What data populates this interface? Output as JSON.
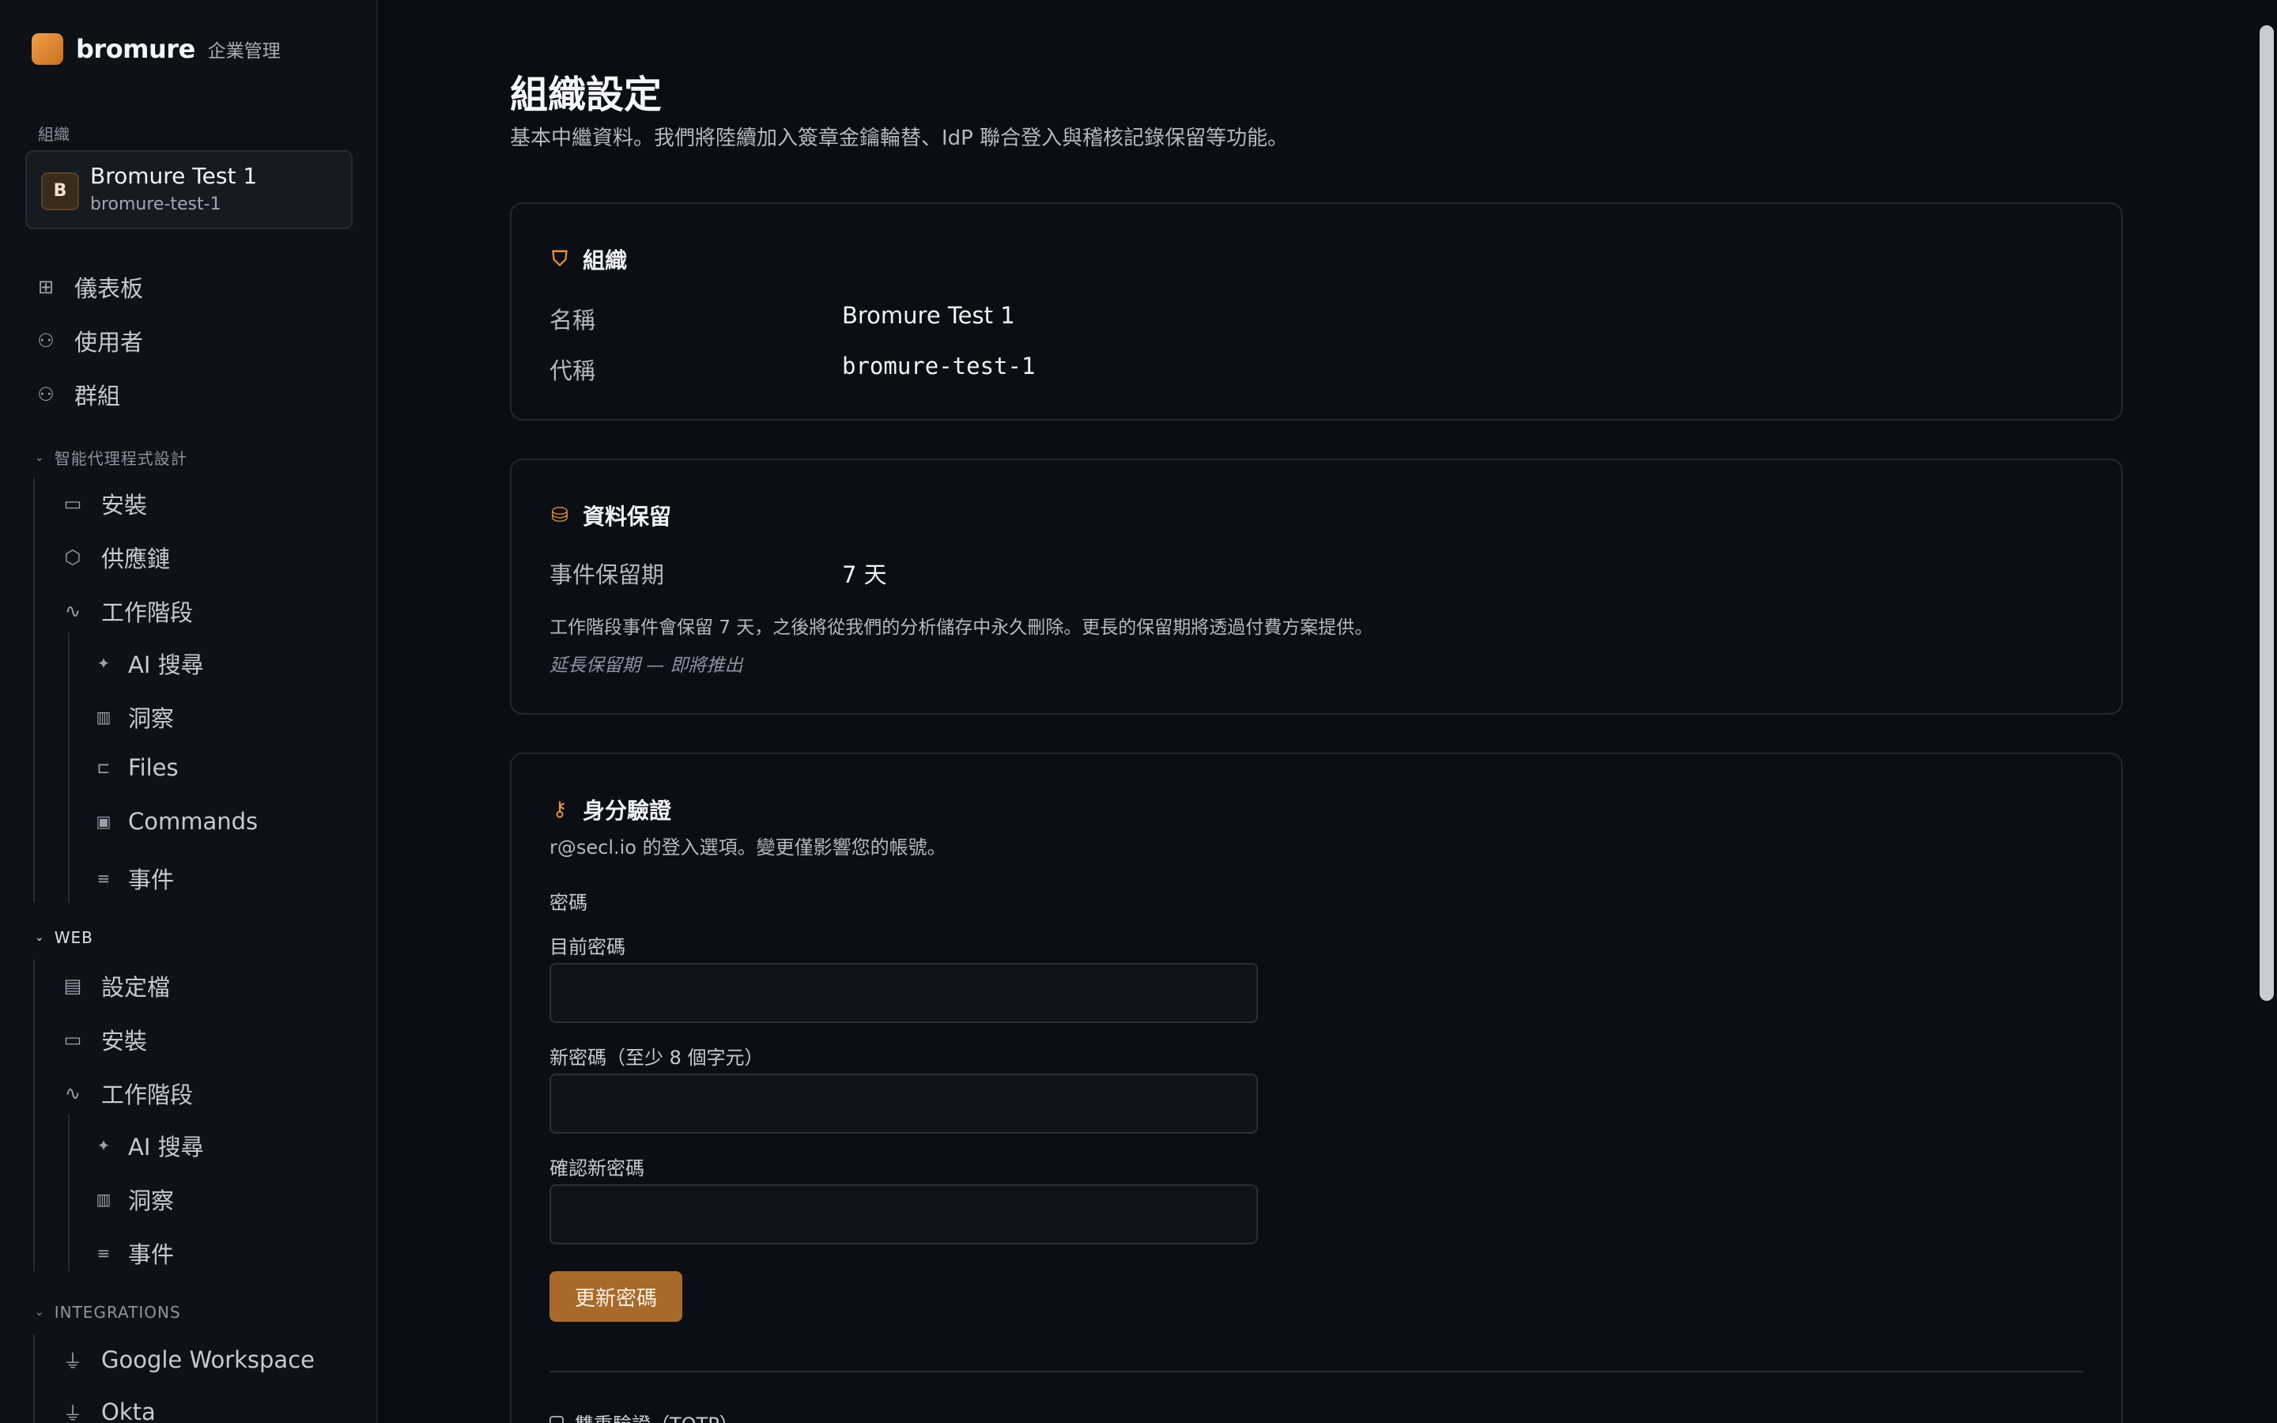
{
  "brand": {
    "name": "bromure",
    "subtitle": "企業管理",
    "logo_color": "#e08a34"
  },
  "org": {
    "section_label": "組織",
    "avatar": "B",
    "name": "Bromure Test 1",
    "slug": "bromure-test-1"
  },
  "nav": {
    "top": [
      {
        "label": "儀表板",
        "icon": "dashboard-icon"
      },
      {
        "label": "使用者",
        "icon": "users-icon"
      },
      {
        "label": "群組",
        "icon": "group-icon"
      }
    ],
    "agents": {
      "header": "智能代理程式設計",
      "items": [
        {
          "label": "安裝",
          "icon": "laptop-icon"
        },
        {
          "label": "供應鏈",
          "icon": "package-icon"
        },
        {
          "label": "工作階段",
          "icon": "activity-icon"
        }
      ],
      "sub": [
        {
          "label": "AI 搜尋",
          "icon": "sparkles-icon"
        },
        {
          "label": "洞察",
          "icon": "bar-chart-icon"
        },
        {
          "label": "Files",
          "icon": "folder-tree-icon"
        },
        {
          "label": "Commands",
          "icon": "terminal-icon"
        },
        {
          "label": "事件",
          "icon": "list-icon"
        }
      ]
    },
    "web": {
      "header": "WEB",
      "items": [
        {
          "label": "設定檔",
          "icon": "folder-settings-icon"
        },
        {
          "label": "安裝",
          "icon": "laptop-icon"
        },
        {
          "label": "工作階段",
          "icon": "activity-icon"
        }
      ],
      "sub": [
        {
          "label": "AI 搜尋",
          "icon": "sparkles-icon"
        },
        {
          "label": "洞察",
          "icon": "bar-chart-icon"
        },
        {
          "label": "事件",
          "icon": "list-icon"
        }
      ]
    },
    "integrations": {
      "header": "INTEGRATIONS",
      "items": [
        {
          "label": "Google Workspace",
          "icon": "plug-icon"
        },
        {
          "label": "Okta",
          "icon": "plug-icon"
        }
      ]
    }
  },
  "page": {
    "title": "組織設定",
    "subtitle": "基本中繼資料。我們將陸續加入簽章金鑰輪替、IdP 聯合登入與稽核記錄保留等功能。"
  },
  "org_card": {
    "title": "組織",
    "name_label": "名稱",
    "name_value": "Bromure Test 1",
    "slug_label": "代稱",
    "slug_value": "bromure-test-1"
  },
  "retention_card": {
    "title": "資料保留",
    "period_label": "事件保留期",
    "period_value": "7 天",
    "note": "工作階段事件會保留 7 天，之後將從我們的分析儲存中永久刪除。更長的保留期將透過付費方案提供。",
    "extend_note": "延長保留期 — 即將推出"
  },
  "auth_card": {
    "title": "身分驗證",
    "subtitle": "r@secl.io 的登入選項。變更僅影響您的帳號。",
    "password_heading": "密碼",
    "current_label": "目前密碼",
    "current_value": "",
    "new_label": "新密碼（至少 8 個字元）",
    "new_value": "",
    "confirm_label": "確認新密碼",
    "confirm_value": "",
    "submit_label": "更新密碼",
    "totp_label": "雙重驗證（TOTP）"
  },
  "colors": {
    "accent": "#e8913a",
    "button": "#a86a2a",
    "background": "#0b0d14",
    "sidebar": "#0f1118"
  }
}
